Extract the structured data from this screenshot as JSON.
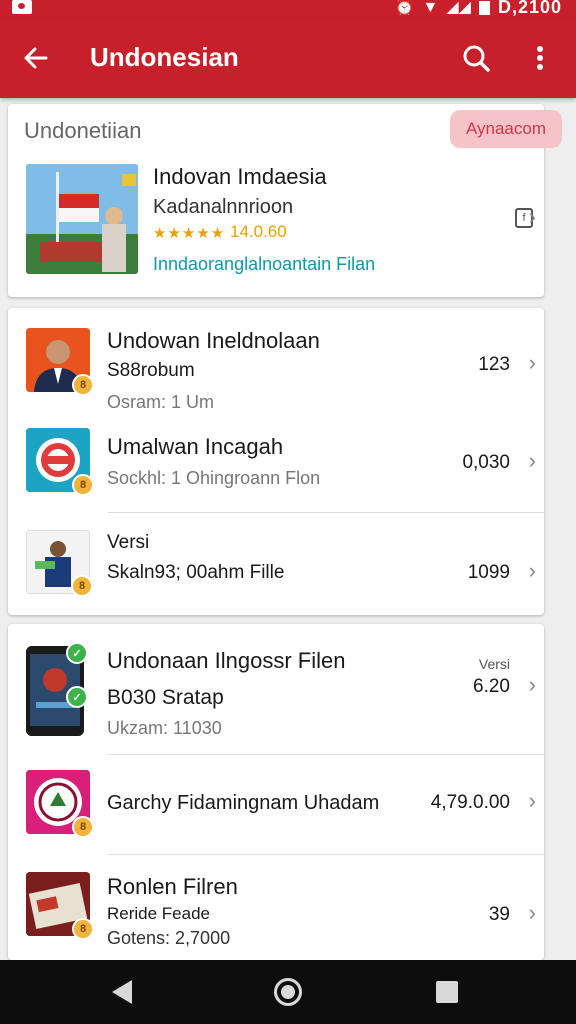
{
  "status_bar": {
    "time": "D,2100"
  },
  "app_bar": {
    "title": "Undonesian",
    "back_icon": "arrow-left-icon",
    "search_icon": "search-icon",
    "more_icon": "more-vertical-icon"
  },
  "featured": {
    "section_title": "Undonetiian",
    "badge": "Aynaacom",
    "title": "Indovan Imdaesia",
    "subtitle": "Kadanalnnrioon",
    "rating": "14.0.60",
    "stars": "★★★★★",
    "link": "Inndaoranglalnoantain Filan"
  },
  "list1": [
    {
      "title": "Undowan Ineldnolaan",
      "subtitle": "S88robum",
      "meta": "Osram: 1 Um",
      "value": "123"
    },
    {
      "title": "Umalwan Incagah",
      "subtitle": "",
      "meta": "Sockhl: 1 Ohingroann Flon",
      "value": "0,030"
    },
    {
      "title": "Versi",
      "subtitle": "Skaln93; 00ahm Fille",
      "meta": "",
      "value": "1099"
    }
  ],
  "list2": [
    {
      "title": "Undonaan Ilngossr Filen",
      "subtitle": "B030 Sratap",
      "meta": "Ukzam: 11030",
      "value_label": "Versi",
      "value": "6.20"
    },
    {
      "title": "Garchy Fidamingnam Uhadam",
      "subtitle": "",
      "meta": "",
      "value": "4,79.0.00"
    },
    {
      "title": "Ronlen Filren",
      "subtitle": "Reride Feade",
      "meta": "Gotens: 2,7000",
      "value": "39"
    }
  ],
  "colors": {
    "primary": "#c8202a",
    "badge_bg": "#f6c4c8",
    "badge_text": "#d0384a",
    "link": "#0e9aa8",
    "rating": "#e9a200"
  }
}
